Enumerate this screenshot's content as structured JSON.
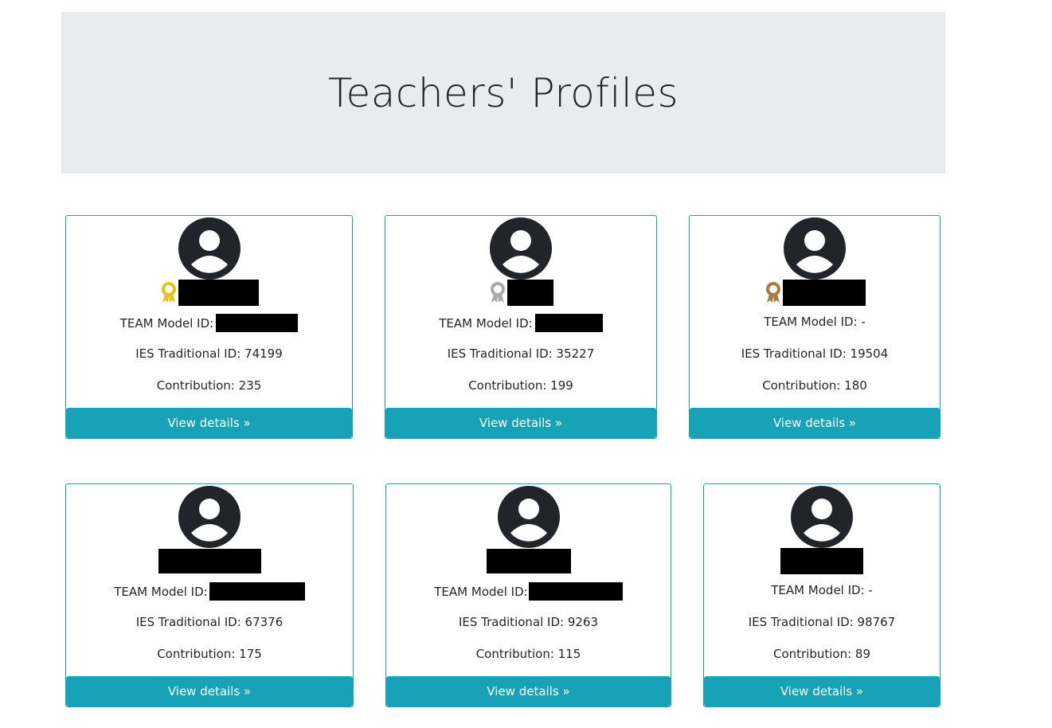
{
  "page": {
    "title": "Teachers' Profiles"
  },
  "colors": {
    "accent": "#17a2b8",
    "jumbotron_bg": "#e9ecef",
    "gold": "#e8c21c",
    "silver": "#a9a9a9",
    "bronze": "#a87a44"
  },
  "cards": [
    {
      "medal": "gold-medal-icon",
      "team_model_label": "TEAM Model ID:",
      "team_model_value": "",
      "ies_label": "IES Traditional ID: 74199",
      "contribution_label": "Contribution: 235",
      "button_label": "View details »"
    },
    {
      "medal": "silver-medal-icon",
      "team_model_label": "TEAM Model ID:",
      "team_model_value": "",
      "ies_label": "IES Traditional ID: 35227",
      "contribution_label": "Contribution: 199",
      "button_label": "View details »"
    },
    {
      "medal": "bronze-medal-icon",
      "team_model_label": "TEAM Model ID: -",
      "team_model_value": "-",
      "ies_label": "IES Traditional ID: 19504",
      "contribution_label": "Contribution: 180",
      "button_label": "View details »"
    },
    {
      "medal": "",
      "team_model_label": "TEAM Model ID:",
      "team_model_value": "",
      "ies_label": "IES Traditional ID: 67376",
      "contribution_label": "Contribution: 175",
      "button_label": "View details »"
    },
    {
      "medal": "",
      "team_model_label": "TEAM Model ID:",
      "team_model_value": "",
      "ies_label": "IES Traditional ID: 9263",
      "contribution_label": "Contribution: 115",
      "button_label": "View details »"
    },
    {
      "medal": "",
      "team_model_label": "TEAM Model ID: -",
      "team_model_value": "-",
      "ies_label": "IES Traditional ID: 98767",
      "contribution_label": "Contribution: 89",
      "button_label": "View details »"
    }
  ]
}
